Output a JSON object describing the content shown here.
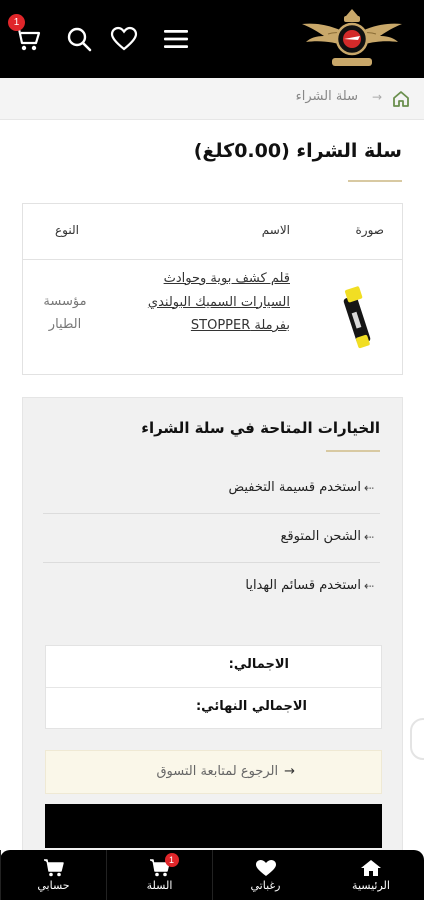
{
  "header": {
    "cart_count": "1",
    "logo_icon": "aviation-wings-logo",
    "icons": [
      "cart-icon",
      "search-icon",
      "heart-icon",
      "menu-icon"
    ]
  },
  "breadcrumb": {
    "current": "سلة الشراء",
    "separator": "→",
    "home_icon": "home-icon"
  },
  "page": {
    "title": "سلة الشراء  (0.00كلغ)"
  },
  "cart_table": {
    "headers": {
      "image": "صورة",
      "name": "الاسم",
      "type": "النوع"
    },
    "items": [
      {
        "name": "قلم كشف بوية وحوادث السيارات السميك البولندي بفرملة STOPPER",
        "brand": "مؤسسة الطيار",
        "thumb_icon": "paint-detector-pen-image"
      }
    ]
  },
  "options_panel": {
    "title": "الخيارات المتاحة في سلة الشراء",
    "options": [
      {
        "label": "استخدم قسيمة التخفيض"
      },
      {
        "label": "الشحن المتوقع"
      },
      {
        "label": "استخدم قسائم الهدايا"
      }
    ],
    "arrow": "⇠",
    "totals": {
      "subtotal_label": "الاجمالي:",
      "grand_total_label": "الاجمالي النهائي:"
    },
    "continue_label": "الرجوع لمتابعة التسوق",
    "continue_arrow": "→"
  },
  "bottom_nav": {
    "items": [
      {
        "label": "الرئيسية",
        "icon": "home-icon"
      },
      {
        "label": "رغباتي",
        "icon": "heart-icon"
      },
      {
        "label": "السلة",
        "icon": "cart-icon",
        "badge": "1"
      },
      {
        "label": "حسابي",
        "icon": "cart-icon"
      }
    ]
  },
  "colors": {
    "header_bg": "#000000",
    "accent_gold": "#d8c9a2",
    "badge_red": "#e0262a",
    "panel_bg": "#f1f1f1",
    "continue_bg": "#faf7e9"
  }
}
